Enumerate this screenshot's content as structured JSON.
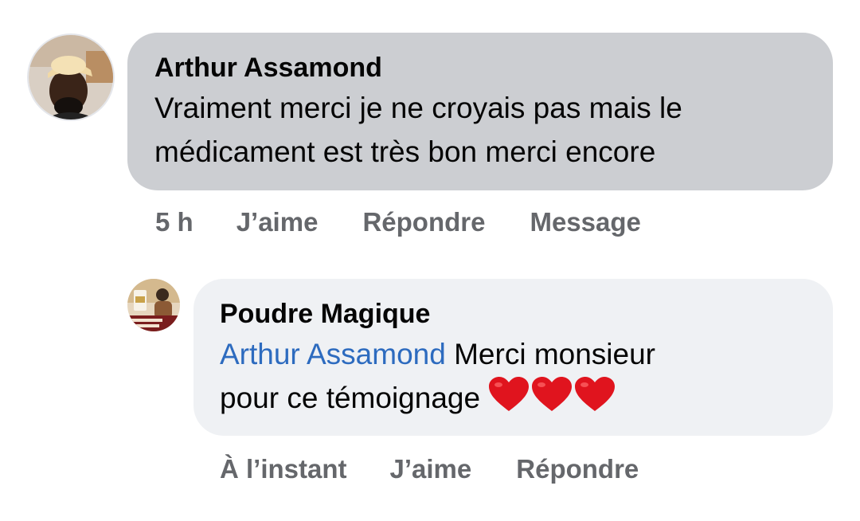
{
  "comments": [
    {
      "author": "Arthur Assamond",
      "lines": [
        "Vraiment merci je ne croyais pas mais le",
        "médicament est très bon merci encore"
      ],
      "timestamp": "5 h",
      "actions": {
        "like": "J’aime",
        "reply": "Répondre",
        "message": "Message"
      },
      "avatar_icon": "profile-photo-man-cap"
    }
  ],
  "reply": {
    "author": "Poudre Magique",
    "mention": "Arthur Assamond",
    "line1_rest": " Merci monsieur",
    "line2": "pour ce témoignage ",
    "emoji": [
      "red-heart",
      "red-heart",
      "red-heart"
    ],
    "timestamp": "À l’instant",
    "actions": {
      "like": "J’aime",
      "reply": "Répondre"
    },
    "avatar_icon": "page-logo-photo"
  },
  "colors": {
    "bubble_comment": "#ccced2",
    "bubble_reply": "#eff1f4",
    "mention": "#2d6bbf",
    "meta_text": "#65676b",
    "heart": "#e0141e"
  }
}
